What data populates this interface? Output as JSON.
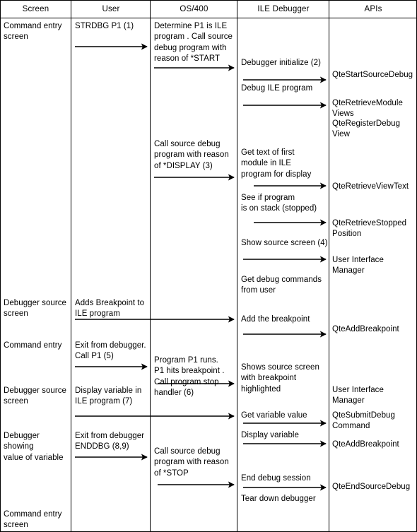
{
  "diagram": {
    "title": "ILE source debugger flow",
    "type": "swimlane-sequence-table",
    "columns": [
      {
        "id": "screen",
        "label": "Screen"
      },
      {
        "id": "user",
        "label": "User"
      },
      {
        "id": "os400",
        "label": "OS/400"
      },
      {
        "id": "ile",
        "label": "ILE Debugger"
      },
      {
        "id": "apis",
        "label": "APIs"
      }
    ],
    "screen_entries": [
      {
        "text": "Command entry\nscreen"
      },
      {
        "text": "Debugger source\nscreen"
      },
      {
        "text": "Command entry"
      },
      {
        "text": "Debugger source\nscreen"
      },
      {
        "text": "Debugger showing\nvalue of variable"
      },
      {
        "text": "Command entry\nscreen"
      }
    ],
    "user_entries": [
      {
        "text": "STRDBG P1 (1)"
      },
      {
        "text": "Adds Breakpoint to\nILE program"
      },
      {
        "text": "Exit from debugger.\nCall P1 (5)"
      },
      {
        "text": "Display variable in\nILE program (7)"
      },
      {
        "text": "Exit from debugger\nENDDBG  (8,9)"
      }
    ],
    "os400_entries": [
      {
        "text": "Determine P1 is ILE\nprogram .  Call source\ndebug program  with\nreason of *START"
      },
      {
        "text": "Call source debug\nprogram with reason\nof *DISPLAY (3)"
      },
      {
        "text": "Program P1 runs.\nP1 hits breakpoint .\nCall program stop\nhandler (6)"
      },
      {
        "text": "Call source debug\nprogram with reason\nof *STOP"
      }
    ],
    "ile_entries": [
      {
        "text": "Debugger initialize (2)"
      },
      {
        "text": "Debug ILE program"
      },
      {
        "text": "Get text of first\nmodule in ILE\nprogram  for display"
      },
      {
        "text": "See if  program\nis on stack (stopped)"
      },
      {
        "text": "Show source screen (4)"
      },
      {
        "text": "Get debug commands\nfrom user"
      },
      {
        "text": "Add the breakpoint"
      },
      {
        "text": "Shows source screen\nwith breakpoint\nhighlighted"
      },
      {
        "text": "Get variable value"
      },
      {
        "text": "Display variable"
      },
      {
        "text": "End debug session"
      },
      {
        "text": "Tear down debugger"
      }
    ],
    "api_entries": [
      {
        "text": "QteStartSourceDebug"
      },
      {
        "text": "QteRetrieveModule\n   Views"
      },
      {
        "text": "QteRegisterDebug\n   View"
      },
      {
        "text": "QteRetrieveViewText"
      },
      {
        "text": "QteRetrieveStopped\n   Position"
      },
      {
        "text": "User Interface\nManager"
      },
      {
        "text": "QteAddBreakpoint"
      },
      {
        "text": "User Interface\nManager"
      },
      {
        "text": "QteSubmitDebug\nCommand"
      },
      {
        "text": "QteAddBreakpoint"
      },
      {
        "text": "QteEndSourceDebug"
      }
    ],
    "colors": {
      "line": "#000000",
      "text": "#000000",
      "background": "#ffffff"
    }
  }
}
